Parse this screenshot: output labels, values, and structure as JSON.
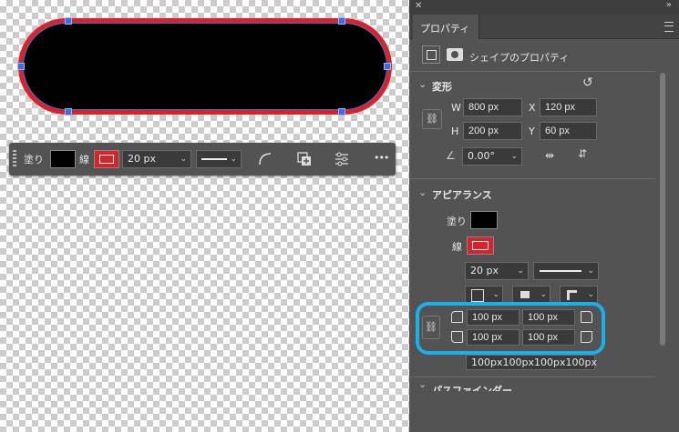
{
  "context_bar": {
    "fill_label": "塗り",
    "stroke_label": "線",
    "stroke_width": "20 px",
    "more_label": "•••"
  },
  "panel": {
    "tab_label": "プロパティ",
    "shape_properties_label": "シェイプのプロパティ",
    "transform": {
      "title": "変形",
      "w_label": "W",
      "w_value": "800 px",
      "x_label": "X",
      "x_value": "120 px",
      "h_label": "H",
      "h_value": "200 px",
      "y_label": "Y",
      "y_value": "60 px",
      "angle_value": "0.00°"
    },
    "appearance": {
      "title": "アピアランス",
      "fill_label": "塗り",
      "stroke_label": "線",
      "stroke_width": "20 px",
      "corner_tl": "100 px",
      "corner_tr": "100 px",
      "corner_bl": "100 px",
      "corner_br": "100 px",
      "corner_combined": "100px100px100px100px"
    },
    "pathfinder_title": "パスファインダー"
  },
  "colors": {
    "stroke": "#d8232a",
    "fill": "#000000",
    "highlight": "#1ab0ec",
    "selection": "#3b6fe0"
  }
}
